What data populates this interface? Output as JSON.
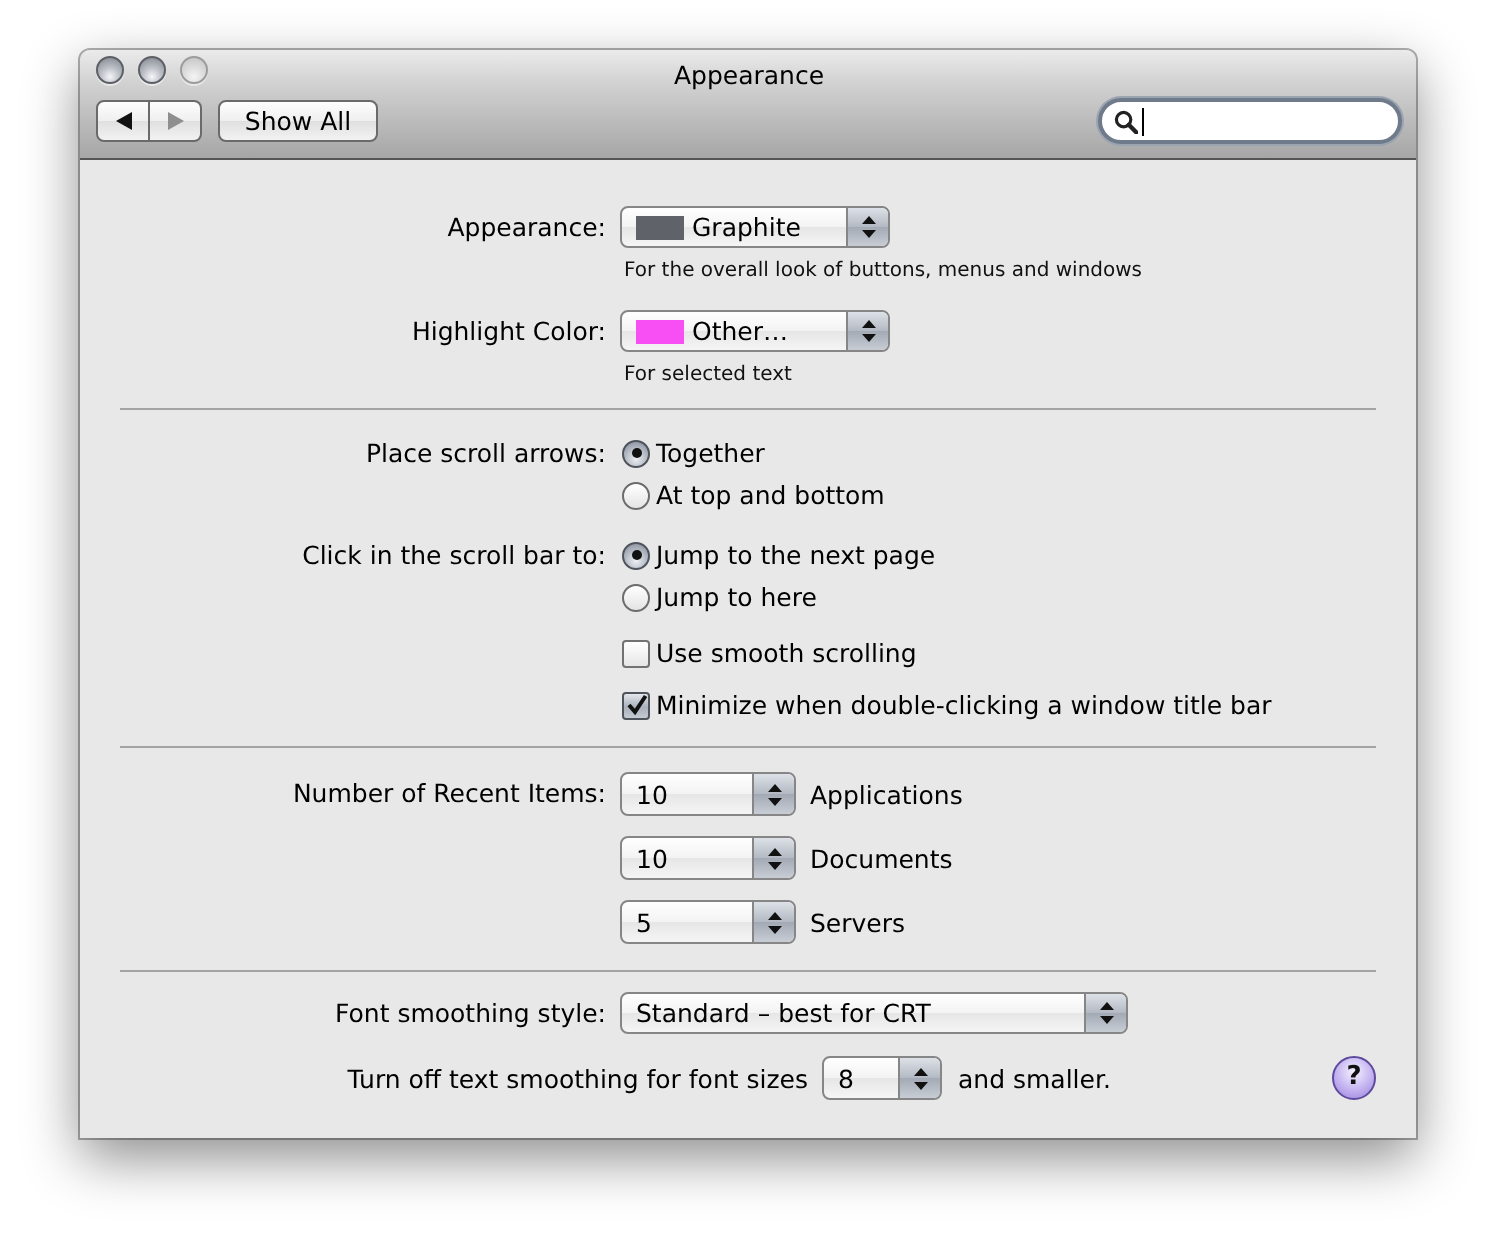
{
  "window": {
    "title": "Appearance",
    "controls": [
      {
        "disabled": false
      },
      {
        "disabled": false
      },
      {
        "disabled": true
      }
    ]
  },
  "toolbar": {
    "nav": [
      {
        "kind": "back",
        "disabled": false
      },
      {
        "kind": "forward",
        "disabled": true
      }
    ],
    "show_all": "Show All",
    "search": {
      "focused": true
    }
  },
  "sections": [
    {
      "rows": [
        {
          "kind": "popup",
          "label": "Appearance:",
          "value": "Graphite",
          "color": "#60626a",
          "hint": "For the overall look of buttons, menus and windows"
        },
        {
          "kind": "popup",
          "label": "Highlight Color:",
          "value": "Other…",
          "color": "#f84ff5",
          "hint": "For selected text"
        }
      ]
    },
    {
      "rows": [
        {
          "kind": "radio",
          "label": "Place scroll arrows:",
          "options": [
            {
              "label": "Together",
              "selected": true
            },
            {
              "label": "At top and bottom",
              "selected": false
            }
          ]
        },
        {
          "kind": "radio",
          "label": "Click in the scroll bar to:",
          "options": [
            {
              "label": "Jump to the next page",
              "selected": true
            },
            {
              "label": "Jump to here",
              "selected": false
            }
          ]
        },
        {
          "kind": "checkbox",
          "text": "Use smooth scrolling",
          "checked": false
        },
        {
          "kind": "checkbox",
          "text": "Minimize when double-clicking a window title bar",
          "checked": true
        }
      ]
    },
    {
      "rows": [
        {
          "kind": "stepper",
          "label": "Number of Recent Items:",
          "value": "10",
          "suffix": "Applications"
        },
        {
          "kind": "stepper",
          "value": "10",
          "suffix": "Documents"
        },
        {
          "kind": "stepper",
          "value": "5",
          "suffix": "Servers"
        }
      ]
    },
    {
      "rows": [
        {
          "kind": "popup",
          "label": "Font smoothing style:",
          "value": "Standard – best for CRT"
        },
        {
          "kind": "inline-popup",
          "label": "Turn off text smoothing for font sizes",
          "value": "8",
          "suffix": "and smaller."
        }
      ]
    }
  ],
  "help": "?"
}
